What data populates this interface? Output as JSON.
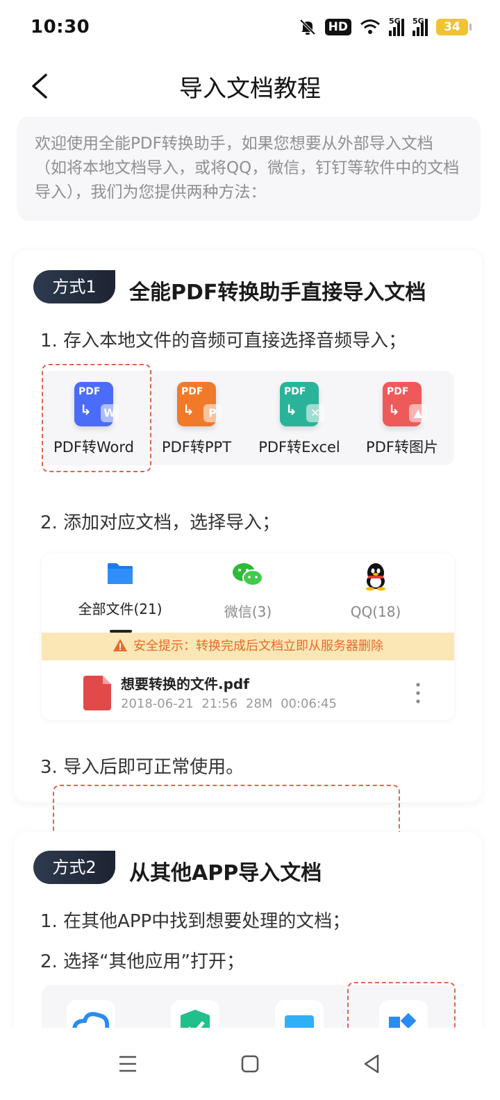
{
  "status_bar": {
    "time": "10:30",
    "network_hd": "HD",
    "sig1": "5G",
    "sig2": "5G",
    "battery": "34",
    "icons": [
      "mute-bell-icon",
      "hd-icon",
      "wifi-icon",
      "signal-5g-icon",
      "signal-5g-icon",
      "battery-icon"
    ]
  },
  "header": {
    "title": "导入文档教程",
    "back_icon": "chevron-left-icon"
  },
  "intro": {
    "text": "欢迎使用全能PDF转换助手，如果您想要从外部导入文档（如将本地文档导入，或将QQ，微信，钉钉等软件中的文档导入），我们为您提供两种方法："
  },
  "method1": {
    "badge": "方式1",
    "title": "全能PDF转换助手直接导入文档",
    "step1": "1. 存入本地文件的音频可直接选择音频导入；",
    "tools": [
      {
        "label": "PDF转Word",
        "tag": "PDF",
        "sub": "W",
        "color": "#4a6cf7"
      },
      {
        "label": "PDF转PPT",
        "tag": "PDF",
        "sub": "P",
        "color": "#f07a2a"
      },
      {
        "label": "PDF转Excel",
        "tag": "PDF",
        "sub": "✕",
        "color": "#2bb39a"
      },
      {
        "label": "PDF转图片",
        "tag": "PDF",
        "sub": "▲",
        "color": "#ee5a5a"
      }
    ],
    "step2": "2. 添加对应文档，选择导入；",
    "file_tabs": [
      {
        "label": "全部文件(21)",
        "icon": "folder-icon"
      },
      {
        "label": "微信(3)",
        "icon": "wechat-icon"
      },
      {
        "label": "QQ(18)",
        "icon": "qq-penguin-icon"
      }
    ],
    "warning": "安全提示：转换完成后文档立即从服务器删除",
    "file": {
      "name": "想要转换的文件.pdf",
      "meta": "2018-06-21 21:56   28M   00:06:45"
    },
    "step3": "3. 导入后即可正常使用。"
  },
  "method2": {
    "badge": "方式2",
    "title": "从其他APP导入文档",
    "step1": "1. 在其他APP中找到想要处理的文档；",
    "step2": "2. 选择“其他应用”打开；"
  },
  "colors": {
    "accent_dashed": "#e0654a",
    "badge_dark": "#1d2433",
    "warning_bg": "#fbe7b5",
    "warning_text": "#e86a2a"
  }
}
